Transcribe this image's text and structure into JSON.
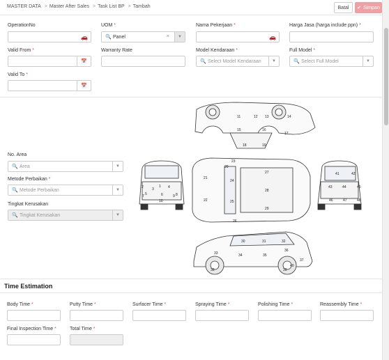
{
  "breadcrumb": {
    "items": [
      "MASTER DATA",
      "Master After Sales",
      "Task List BP",
      "Tambah"
    ],
    "separator": ">"
  },
  "actions": {
    "cancel_label": "Batal",
    "save_label": "Simpan"
  },
  "form": {
    "operation_no": {
      "label": "OperationNo",
      "value": ""
    },
    "uom": {
      "label": "UOM",
      "value": "Panel",
      "required": "*"
    },
    "nama_pekerjaan": {
      "label": "Nama Pekerjaan",
      "value": "",
      "required": "*"
    },
    "harga_jasa": {
      "label": "Harga Jasa (harga include ppn)",
      "value": "",
      "required": "*"
    },
    "valid_from": {
      "label": "Valid From",
      "value": "",
      "required": "*"
    },
    "warranty_rate": {
      "label": "Warranty Rate",
      "value": ""
    },
    "model_kendaraan": {
      "label": "Model Kendaraan",
      "placeholder": "Select Model Kendaraan",
      "required": "*"
    },
    "full_model": {
      "label": "Full Model",
      "placeholder": "Select Full Model",
      "required": "*"
    },
    "valid_to": {
      "label": "Valid To",
      "value": "",
      "required": "*"
    }
  },
  "area": {
    "no_area": {
      "label": "No. Area",
      "placeholder": "Area"
    },
    "metode": {
      "label": "Metode Perbaikan",
      "placeholder": "Metode Perbaikan",
      "required": "*"
    },
    "tingkat": {
      "label": "Tingkat Kerusakan",
      "placeholder": "Tingkat Kerusakan"
    }
  },
  "car_zones": {
    "top": [
      "11",
      "12",
      "13",
      "14",
      "15",
      "16",
      "17",
      "18",
      "19"
    ],
    "front": [
      "1",
      "2",
      "3",
      "4",
      "5",
      "6",
      "7",
      "8",
      "9",
      "10"
    ],
    "roof": [
      "20",
      "21",
      "22",
      "23",
      "24",
      "25",
      "26",
      "27",
      "28",
      "29"
    ],
    "rear": [
      "41",
      "42",
      "43",
      "44",
      "45",
      "46",
      "47",
      "48"
    ],
    "bottom": [
      "30",
      "31",
      "32",
      "33",
      "34",
      "35",
      "36",
      "37",
      "38",
      "39",
      "40"
    ]
  },
  "time_estimation": {
    "title": "Time Estimation",
    "body_time": {
      "label": "Body Time",
      "required": "*",
      "value": ""
    },
    "putty_time": {
      "label": "Putty Time",
      "required": "*",
      "value": ""
    },
    "surfacer_time": {
      "label": "Surfacer Time",
      "required": "*",
      "value": ""
    },
    "spraying_time": {
      "label": "Spraying Time",
      "required": "*",
      "value": ""
    },
    "polishing_time": {
      "label": "Polishing Time",
      "required": "*",
      "value": ""
    },
    "reassembly_time": {
      "label": "Reassembly Time",
      "required": "*",
      "value": ""
    },
    "final_inspection_time": {
      "label": "Final Inspection Time",
      "required": "*",
      "value": ""
    },
    "total_time": {
      "label": "Total Time",
      "required": "*",
      "value": ""
    }
  },
  "icons": {
    "car": "car-icon",
    "calendar": "calendar-icon",
    "search": "search-icon",
    "caret": "chevron-down-icon",
    "check": "check-icon",
    "clear": "clear-icon"
  },
  "colors": {
    "required": "#d9534f",
    "save_button": "#f0a0a4",
    "disabled": "#eeeeee"
  }
}
